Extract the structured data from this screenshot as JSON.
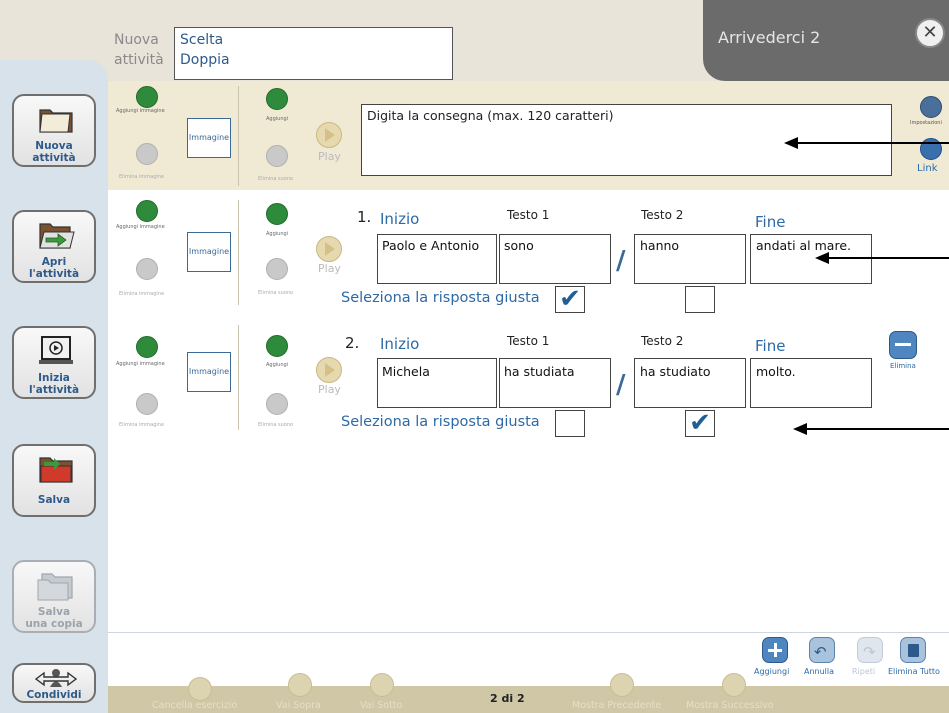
{
  "header": {
    "new_activity_label": "Nuova\nattività",
    "activity_type": "Scelta\nDoppia",
    "activity_title": "Arrivederci 2",
    "close_symbol": "✕"
  },
  "sidebar": {
    "items": [
      {
        "label": "Nuova\nattività",
        "icon": "folder-icon",
        "enabled": true
      },
      {
        "label": "Apri\nl'attività",
        "icon": "open-folder-icon",
        "enabled": true
      },
      {
        "label": "Inizia\nl'attività",
        "icon": "play-screen-icon",
        "enabled": true
      },
      {
        "label": "Salva",
        "icon": "save-folder-icon",
        "enabled": true
      },
      {
        "label": "Salva\nuna copia",
        "icon": "save-copy-icon",
        "enabled": false
      },
      {
        "label": "Condividi",
        "icon": "share-icon",
        "enabled": true
      }
    ]
  },
  "media": {
    "add_image": "Aggiungi immagine",
    "delete_image": "Elimina immagine",
    "image_placeholder": "Immagine",
    "add_sound": "Aggiungi",
    "delete_sound": "Elimina suono",
    "play": "Play"
  },
  "instruction": {
    "placeholder": "Digita  la consegna (max. 120 caratteri)",
    "settings": "Impostazioni",
    "link": "Link"
  },
  "columns": {
    "start": "Inizio",
    "text1": "Testo 1",
    "text2": "Testo 2",
    "end": "Fine"
  },
  "select_label": "Seleziona la risposta giusta",
  "delete_label": "Elimina",
  "rows": [
    {
      "number": "1.",
      "start": "Paolo e Antonio",
      "text1": "sono",
      "text2": "hanno",
      "end": "andati al mare.",
      "correct": "text1"
    },
    {
      "number": "2.",
      "start": "Michela",
      "text1": "ha studiata",
      "text2": "ha studiato",
      "end": "molto.",
      "correct": "text2"
    }
  ],
  "toolbar": {
    "add": "Aggiungi",
    "undo": "Annulla",
    "redo": "Ripeti",
    "delete_all": "Elimina Tutto"
  },
  "bottom_nav": {
    "clear_exercise": "Cancella esercizio",
    "go_up": "Vai Sopra",
    "go_down": "Vai Sotto",
    "page": "2 di 2",
    "previous": "Mostra Precedente",
    "next": "Mostra Successivo"
  },
  "colors": {
    "accent": "#2d6aa5",
    "strip": "#f0e9d4",
    "sidebar": "#d8e2ea",
    "title_tab": "#6b6b6b"
  }
}
